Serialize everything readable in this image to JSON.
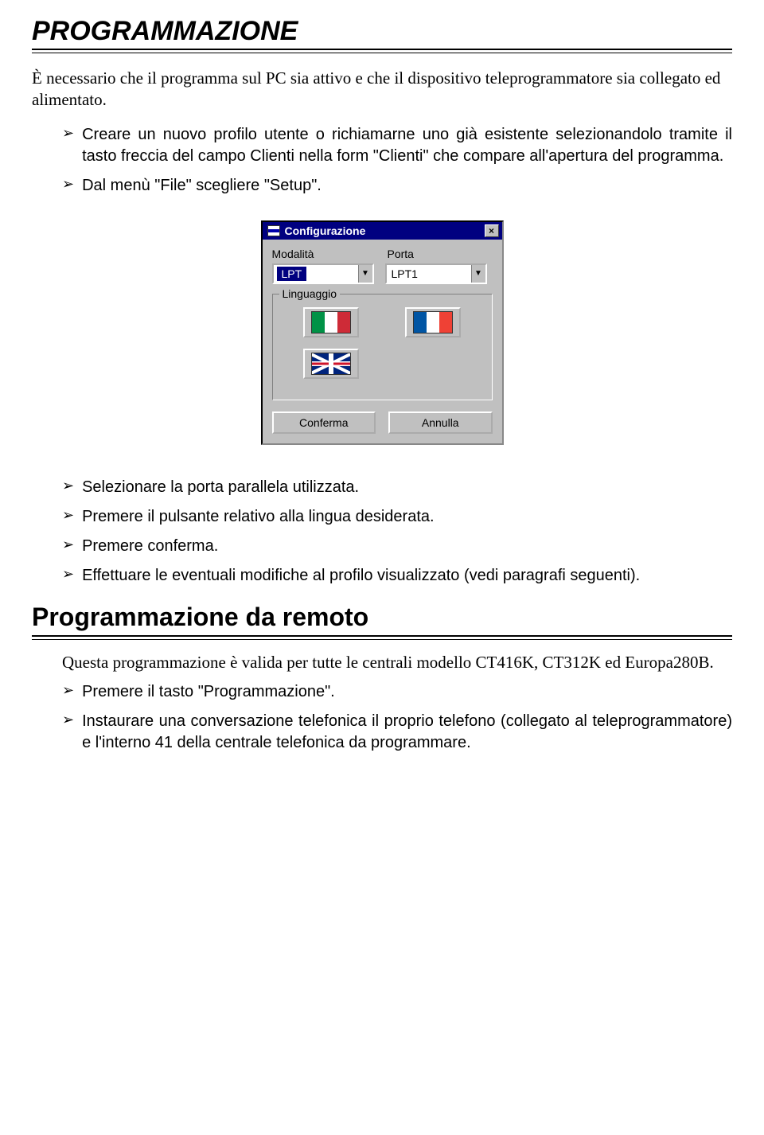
{
  "heading1": "PROGRAMMAZIONE",
  "intro": "È necessario che il programma sul PC sia attivo e che il dispositivo teleprogrammatore sia collegato ed alimentato.",
  "bulletsTop": [
    "Creare un nuovo profilo utente o richiamarne uno già esistente selezionandolo tramite il tasto freccia del campo Clienti nella form \"Clienti\" che compare all'apertura del programma.",
    "Dal menù \"File\" scegliere \"Setup\"."
  ],
  "dialog": {
    "title": "Configurazione",
    "modalitaLabel": "Modalità",
    "portaLabel": "Porta",
    "modalitaValue": "LPT",
    "portaValue": "LPT1",
    "linguaggioLabel": "Linguaggio",
    "conferma": "Conferma",
    "annulla": "Annulla",
    "closeX": "×"
  },
  "bulletsMid": [
    "Selezionare la porta parallela utilizzata.",
    "Premere il pulsante relativo alla lingua desiderata.",
    "Premere conferma.",
    "Effettuare le eventuali modifiche al profilo visualizzato (vedi paragrafi seguenti)."
  ],
  "heading2": "Programmazione da remoto",
  "remotoIntro": "Questa programmazione è valida per tutte le centrali modello CT416K, CT312K ed Europa280B.",
  "bulletsBottom": [
    "Premere il tasto \"Programmazione\".",
    "Instaurare una conversazione telefonica il proprio telefono (collegato al teleprogrammatore) e l'interno 41 della centrale telefonica da programmare."
  ]
}
